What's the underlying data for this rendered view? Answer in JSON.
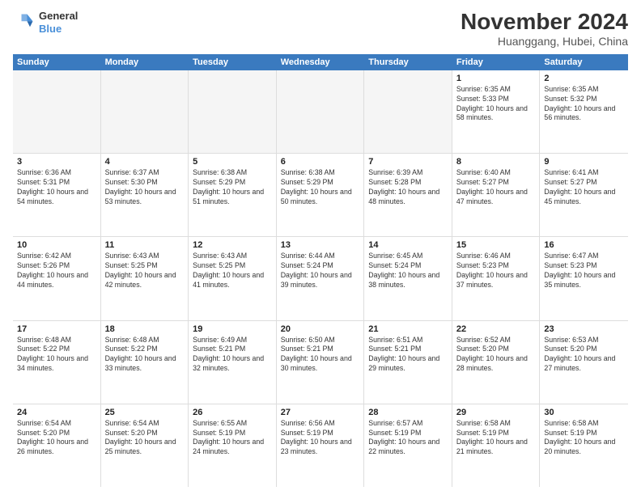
{
  "logo": {
    "line1": "General",
    "line2": "Blue"
  },
  "title": "November 2024",
  "location": "Huanggang, Hubei, China",
  "header_days": [
    "Sunday",
    "Monday",
    "Tuesday",
    "Wednesday",
    "Thursday",
    "Friday",
    "Saturday"
  ],
  "weeks": [
    [
      {
        "day": "",
        "info": ""
      },
      {
        "day": "",
        "info": ""
      },
      {
        "day": "",
        "info": ""
      },
      {
        "day": "",
        "info": ""
      },
      {
        "day": "",
        "info": ""
      },
      {
        "day": "1",
        "info": "Sunrise: 6:35 AM\nSunset: 5:33 PM\nDaylight: 10 hours and 58 minutes."
      },
      {
        "day": "2",
        "info": "Sunrise: 6:35 AM\nSunset: 5:32 PM\nDaylight: 10 hours and 56 minutes."
      }
    ],
    [
      {
        "day": "3",
        "info": "Sunrise: 6:36 AM\nSunset: 5:31 PM\nDaylight: 10 hours and 54 minutes."
      },
      {
        "day": "4",
        "info": "Sunrise: 6:37 AM\nSunset: 5:30 PM\nDaylight: 10 hours and 53 minutes."
      },
      {
        "day": "5",
        "info": "Sunrise: 6:38 AM\nSunset: 5:29 PM\nDaylight: 10 hours and 51 minutes."
      },
      {
        "day": "6",
        "info": "Sunrise: 6:38 AM\nSunset: 5:29 PM\nDaylight: 10 hours and 50 minutes."
      },
      {
        "day": "7",
        "info": "Sunrise: 6:39 AM\nSunset: 5:28 PM\nDaylight: 10 hours and 48 minutes."
      },
      {
        "day": "8",
        "info": "Sunrise: 6:40 AM\nSunset: 5:27 PM\nDaylight: 10 hours and 47 minutes."
      },
      {
        "day": "9",
        "info": "Sunrise: 6:41 AM\nSunset: 5:27 PM\nDaylight: 10 hours and 45 minutes."
      }
    ],
    [
      {
        "day": "10",
        "info": "Sunrise: 6:42 AM\nSunset: 5:26 PM\nDaylight: 10 hours and 44 minutes."
      },
      {
        "day": "11",
        "info": "Sunrise: 6:43 AM\nSunset: 5:25 PM\nDaylight: 10 hours and 42 minutes."
      },
      {
        "day": "12",
        "info": "Sunrise: 6:43 AM\nSunset: 5:25 PM\nDaylight: 10 hours and 41 minutes."
      },
      {
        "day": "13",
        "info": "Sunrise: 6:44 AM\nSunset: 5:24 PM\nDaylight: 10 hours and 39 minutes."
      },
      {
        "day": "14",
        "info": "Sunrise: 6:45 AM\nSunset: 5:24 PM\nDaylight: 10 hours and 38 minutes."
      },
      {
        "day": "15",
        "info": "Sunrise: 6:46 AM\nSunset: 5:23 PM\nDaylight: 10 hours and 37 minutes."
      },
      {
        "day": "16",
        "info": "Sunrise: 6:47 AM\nSunset: 5:23 PM\nDaylight: 10 hours and 35 minutes."
      }
    ],
    [
      {
        "day": "17",
        "info": "Sunrise: 6:48 AM\nSunset: 5:22 PM\nDaylight: 10 hours and 34 minutes."
      },
      {
        "day": "18",
        "info": "Sunrise: 6:48 AM\nSunset: 5:22 PM\nDaylight: 10 hours and 33 minutes."
      },
      {
        "day": "19",
        "info": "Sunrise: 6:49 AM\nSunset: 5:21 PM\nDaylight: 10 hours and 32 minutes."
      },
      {
        "day": "20",
        "info": "Sunrise: 6:50 AM\nSunset: 5:21 PM\nDaylight: 10 hours and 30 minutes."
      },
      {
        "day": "21",
        "info": "Sunrise: 6:51 AM\nSunset: 5:21 PM\nDaylight: 10 hours and 29 minutes."
      },
      {
        "day": "22",
        "info": "Sunrise: 6:52 AM\nSunset: 5:20 PM\nDaylight: 10 hours and 28 minutes."
      },
      {
        "day": "23",
        "info": "Sunrise: 6:53 AM\nSunset: 5:20 PM\nDaylight: 10 hours and 27 minutes."
      }
    ],
    [
      {
        "day": "24",
        "info": "Sunrise: 6:54 AM\nSunset: 5:20 PM\nDaylight: 10 hours and 26 minutes."
      },
      {
        "day": "25",
        "info": "Sunrise: 6:54 AM\nSunset: 5:20 PM\nDaylight: 10 hours and 25 minutes."
      },
      {
        "day": "26",
        "info": "Sunrise: 6:55 AM\nSunset: 5:19 PM\nDaylight: 10 hours and 24 minutes."
      },
      {
        "day": "27",
        "info": "Sunrise: 6:56 AM\nSunset: 5:19 PM\nDaylight: 10 hours and 23 minutes."
      },
      {
        "day": "28",
        "info": "Sunrise: 6:57 AM\nSunset: 5:19 PM\nDaylight: 10 hours and 22 minutes."
      },
      {
        "day": "29",
        "info": "Sunrise: 6:58 AM\nSunset: 5:19 PM\nDaylight: 10 hours and 21 minutes."
      },
      {
        "day": "30",
        "info": "Sunrise: 6:58 AM\nSunset: 5:19 PM\nDaylight: 10 hours and 20 minutes."
      }
    ]
  ]
}
